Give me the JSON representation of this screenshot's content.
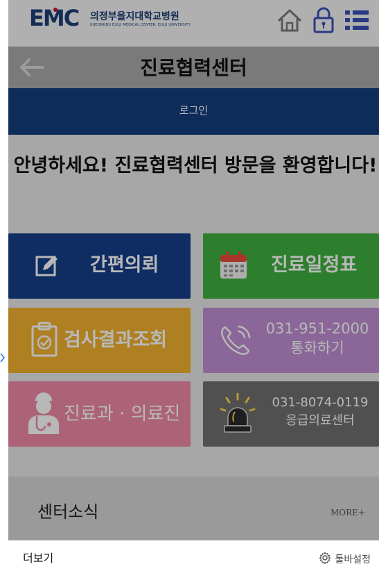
{
  "header": {
    "logo_mark": "EMC",
    "logo_kr": "의정부을지대학교병원",
    "logo_en": "UIJEONGBU EULJI MEDICAL CENTER, EULJI UNIVERSITY",
    "icons": [
      "home-icon",
      "lock-icon",
      "menu-icon"
    ]
  },
  "titlebar": {
    "title": "진료협력센터",
    "back_icon": "arrow-left-icon"
  },
  "loginbar": {
    "label": "로그인"
  },
  "greeting": "안녕하세요! 진료협력센터 방문을 환영합니다!",
  "tiles": [
    {
      "label": "간편의뢰",
      "icon": "edit-icon",
      "color": "#163f8a"
    },
    {
      "label": "진료일정표",
      "icon": "calendar-icon",
      "color": "#3fb13f"
    },
    {
      "label": "검사결과조회",
      "icon": "clipboard-icon",
      "color": "#f2b230"
    },
    {
      "line1": "031-951-2000",
      "line2": "통화하기",
      "icon": "phone-icon",
      "color": "#bf8fd3"
    },
    {
      "label": "진료과 · 의료진",
      "icon": "doctor-icon",
      "color": "#ef8aa5"
    },
    {
      "line1": "031-8074-0119",
      "line2": "응급의료센터",
      "icon": "siren-icon",
      "color": "#6f6f6f"
    }
  ],
  "news": {
    "title": "센터소식",
    "more": "MORE+"
  },
  "footer": {
    "more_label": "더보기",
    "toolbar_settings": "툴바설정",
    "settings_icon": "gear-icon"
  }
}
